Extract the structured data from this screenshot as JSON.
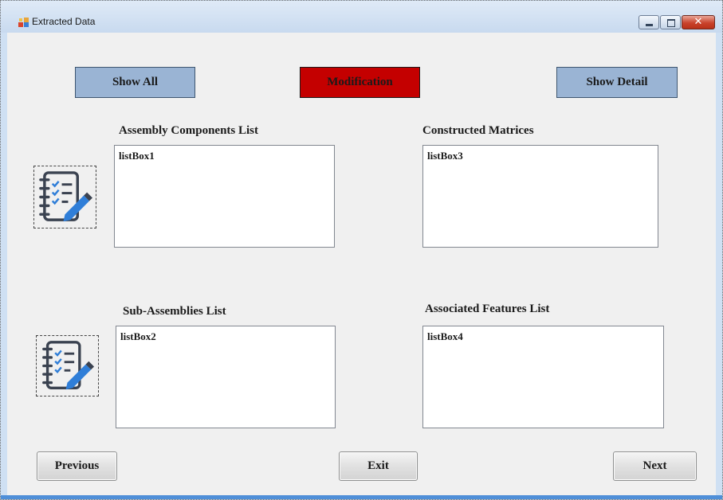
{
  "window": {
    "title": "Extracted Data",
    "close_glyph": "✕"
  },
  "toolbar": {
    "show_all": "Show All",
    "modification": "Modification",
    "show_detail": "Show Detail"
  },
  "lists": {
    "assembly_components": {
      "label": "Assembly Components List",
      "placeholder": "listBox1"
    },
    "constructed_matrices": {
      "label": "Constructed Matrices",
      "placeholder": "listBox3"
    },
    "sub_assemblies": {
      "label": "Sub-Assemblies List",
      "placeholder": "listBox2"
    },
    "associated_features": {
      "label": "Associated Features List",
      "placeholder": "listBox4"
    }
  },
  "nav": {
    "previous": "Previous",
    "exit": "Exit",
    "next": "Next"
  },
  "icons": {
    "list_icon": "checklist-notepad-icon",
    "app_icon": "window-app-icon"
  },
  "colors": {
    "accent_blue": "#9ab4d4",
    "accent_red": "#c40000",
    "icon_dark": "#3a4250",
    "icon_blue": "#2f7ed8"
  }
}
